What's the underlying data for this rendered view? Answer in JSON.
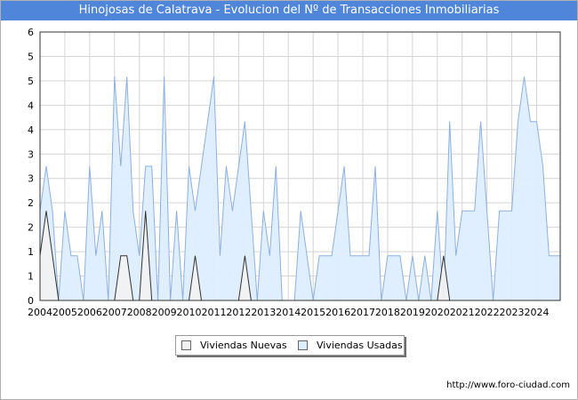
{
  "title": "Hinojosas de Calatrava - Evolucion del Nº de Transacciones Inmobiliarias",
  "footer": "http://www.foro-ciudad.com",
  "colors": {
    "title_bg": "#4f86d9",
    "nuevas_fill": "#f2f2f2",
    "nuevas_line": "#333333",
    "usadas_fill": "#ddeeff",
    "usadas_line": "#8db0e0"
  },
  "legend": {
    "nuevas": "Viviendas Nuevas",
    "usadas": "Viviendas Usadas"
  },
  "chart_data": {
    "type": "area",
    "title": "Hinojosas de Calatrava - Evolucion del Nº de Transacciones Inmobiliarias",
    "xlabel": "",
    "ylabel": "",
    "ylim": [
      0,
      6
    ],
    "y_ticks": [
      "0",
      "1",
      "1",
      "2",
      "2",
      "3",
      "3",
      "4",
      "4",
      "5",
      "5",
      "6"
    ],
    "x_ticks": [
      "2004",
      "2005",
      "2006",
      "2007",
      "2008",
      "2009",
      "2010",
      "2011",
      "2012",
      "2013",
      "2014",
      "2015",
      "2016",
      "2017",
      "2018",
      "2019",
      "2020",
      "2021",
      "2022",
      "2023",
      "2024"
    ],
    "x_range": [
      2004,
      2024.95
    ],
    "grid": true,
    "legend_position": "bottom",
    "series": [
      {
        "name": "Viviendas Nuevas",
        "x": [
          2004,
          2004.25,
          2004.5,
          2004.75,
          2007,
          2007.25,
          2007.5,
          2007.75,
          2008,
          2008.25,
          2008.5,
          2010,
          2010.25,
          2010.5,
          2012,
          2012.25,
          2012.5,
          2020,
          2020.25,
          2020.5,
          2024.95
        ],
        "y": [
          1,
          2,
          1,
          0,
          0,
          1,
          1,
          0,
          0,
          2,
          0,
          0,
          1,
          0,
          0,
          1,
          0,
          0,
          1,
          0,
          0
        ]
      },
      {
        "name": "Viviendas Usadas",
        "x": [
          2004,
          2004.25,
          2004.5,
          2004.75,
          2005,
          2005.25,
          2005.5,
          2005.75,
          2006,
          2006.25,
          2006.5,
          2006.75,
          2007,
          2007.25,
          2007.5,
          2007.75,
          2008,
          2008.25,
          2008.5,
          2008.75,
          2009,
          2009.25,
          2009.5,
          2009.75,
          2010,
          2010.25,
          2010.5,
          2010.75,
          2011,
          2011.25,
          2011.5,
          2011.75,
          2012,
          2012.25,
          2012.5,
          2012.75,
          2013,
          2013.25,
          2013.5,
          2013.75,
          2014,
          2014.25,
          2014.5,
          2014.75,
          2015,
          2015.25,
          2015.5,
          2015.75,
          2016,
          2016.25,
          2016.5,
          2016.75,
          2017,
          2017.25,
          2017.5,
          2017.75,
          2018,
          2018.25,
          2018.5,
          2018.75,
          2019,
          2019.25,
          2019.5,
          2019.75,
          2020,
          2020.25,
          2020.5,
          2020.75,
          2021,
          2021.25,
          2021.5,
          2021.75,
          2022,
          2022.25,
          2022.5,
          2022.75,
          2023,
          2023.25,
          2023.5,
          2023.75,
          2024,
          2024.25,
          2024.5,
          2024.75,
          2024.95
        ],
        "y": [
          2,
          3,
          2,
          0,
          2,
          1,
          1,
          0,
          3,
          1,
          2,
          0,
          5,
          3,
          5,
          2,
          1,
          3,
          3,
          0,
          5,
          0,
          2,
          0,
          3,
          2,
          3,
          4,
          5,
          1,
          3,
          2,
          3,
          4,
          2,
          0,
          2,
          1,
          3,
          0,
          0,
          0,
          2,
          1,
          0,
          1,
          1,
          1,
          2,
          3,
          1,
          1,
          1,
          1,
          3,
          0,
          1,
          1,
          1,
          0,
          1,
          0,
          1,
          0,
          2,
          0,
          4,
          1,
          2,
          2,
          2,
          4,
          2,
          0,
          2,
          2,
          2,
          4,
          5,
          4,
          4,
          3,
          1,
          1,
          1
        ]
      }
    ]
  }
}
